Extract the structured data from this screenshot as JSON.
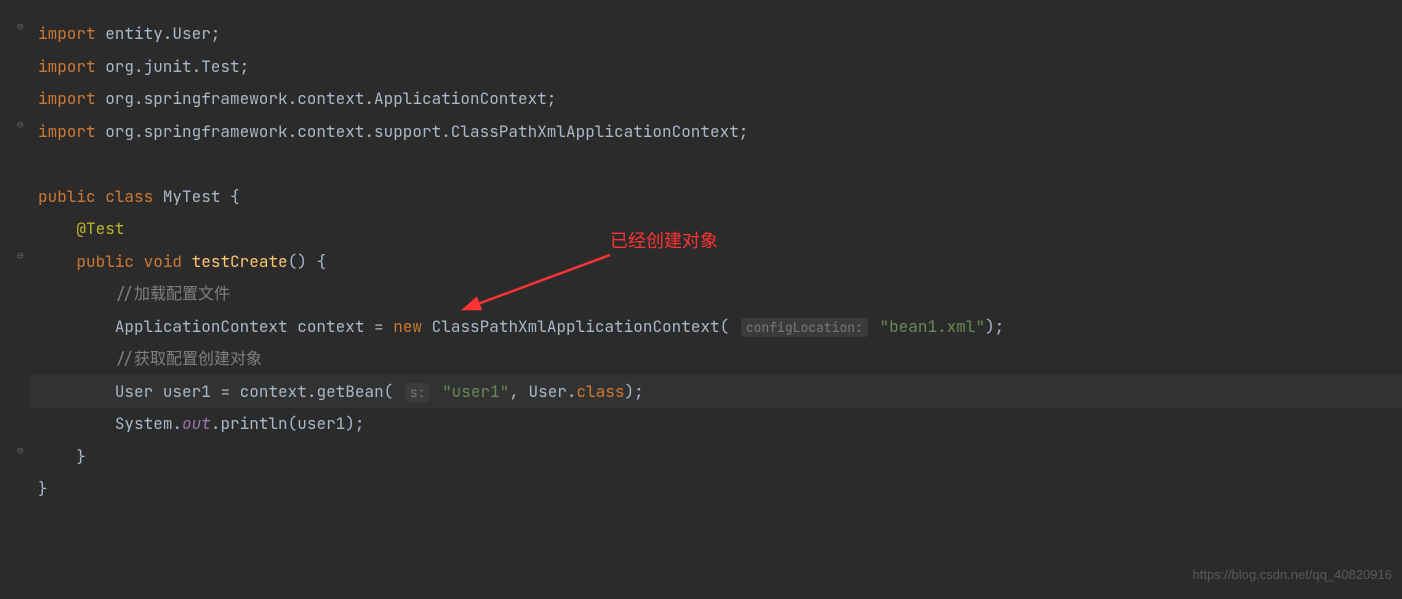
{
  "code": {
    "line1": {
      "keyword": "import",
      "rest": " entity.User;"
    },
    "line2": {
      "keyword": "import",
      "rest": " org.junit.Test;"
    },
    "line3": {
      "keyword": "import",
      "rest": " org.springframework.context.ApplicationContext;"
    },
    "line4": {
      "keyword": "import",
      "rest": " org.springframework.context.support.ClassPathXmlApplicationContext;"
    },
    "line6": {
      "kpublic": "public",
      "kclass": "class",
      "name": " MyTest ",
      "brace": "{"
    },
    "line7": {
      "annotation": "@Test"
    },
    "line8": {
      "kpublic": "public",
      "kvoid": "void",
      "method": "testCreate",
      "parens": "() {",
      "space": " "
    },
    "line9": {
      "comment": "//加载配置文件"
    },
    "line10": {
      "type": "ApplicationContext ",
      "var": "context",
      "eq": " = ",
      "knew": "new",
      "ctor": " ClassPathXmlApplicationContext( ",
      "hint": "configLocation:",
      "str": " \"bean1.xml\"",
      "end": ");"
    },
    "line11": {
      "comment": "//获取配置创建对象"
    },
    "line12": {
      "type": "User ",
      "var": "user1",
      "eq": " = ",
      "obj": "context",
      "dot": ".",
      "method": "getBean",
      "open": "( ",
      "hint": "s:",
      "str": " \"user1\"",
      "comma": ", User.",
      "kclass": "class",
      "end": ");"
    },
    "line13": {
      "cls": "System",
      "dot1": ".",
      "out": "out",
      "dot2": ".",
      "method": "println",
      "open": "(",
      "arg": "user1",
      "end": ");"
    },
    "line14": {
      "brace": "}"
    },
    "line15": {
      "brace": "}"
    }
  },
  "annotation": {
    "text": "已经创建对象"
  },
  "watermark": "https://blog.csdn.net/qq_40820916"
}
